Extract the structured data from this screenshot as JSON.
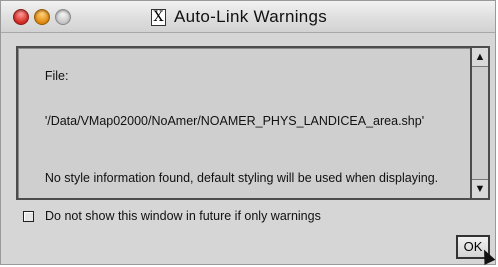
{
  "window": {
    "title": "Auto-Link Warnings",
    "app_icon": "x-window-icon",
    "controls": [
      "close",
      "minimize",
      "zoom"
    ]
  },
  "message": {
    "line1": "File:",
    "line2": "'/Data/VMap02000/NoAmer/NOAMER_PHYS_LANDICEA_area.shp'",
    "line3": "No style information found, default styling will be used when displaying."
  },
  "scrollbar": {
    "up_arrow": "▲",
    "down_arrow": "▼"
  },
  "option": {
    "label": "Do not show this window in future if only warnings",
    "checked": false
  },
  "buttons": {
    "ok_label": "OK"
  }
}
